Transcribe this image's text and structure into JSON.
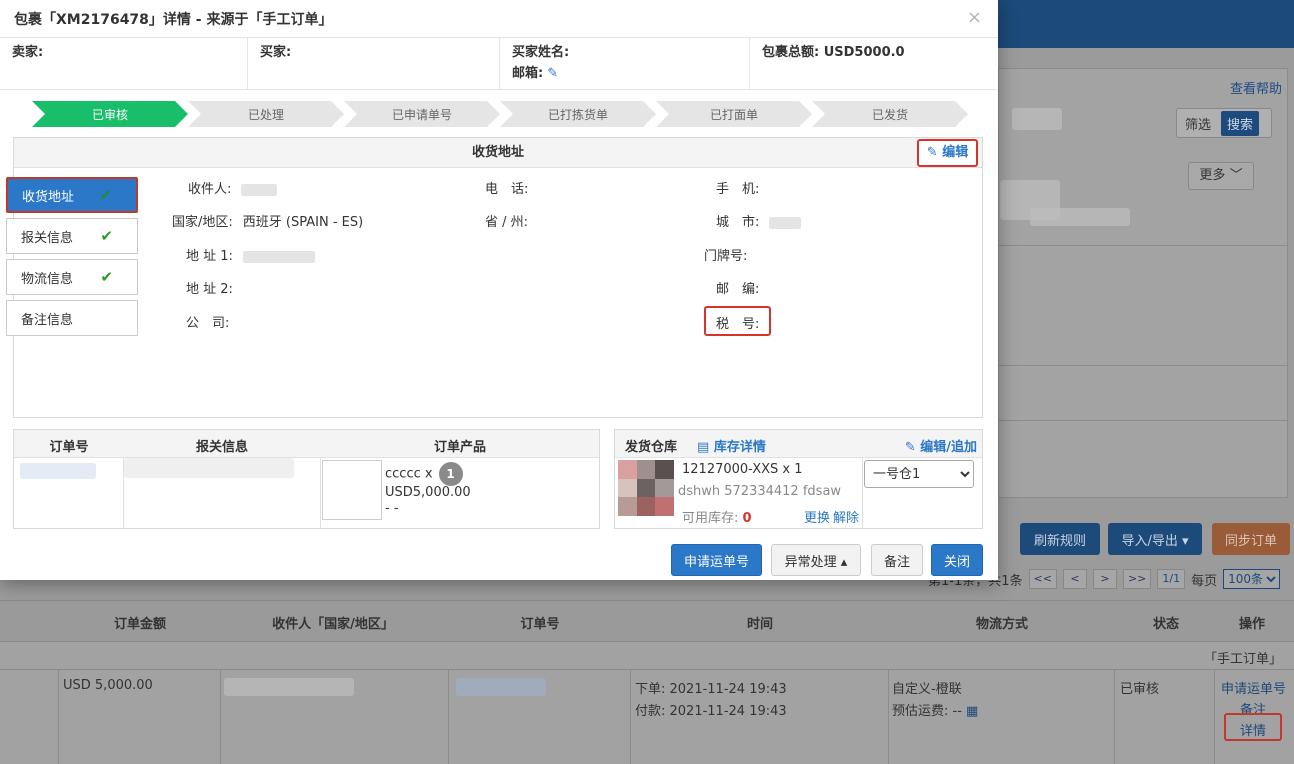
{
  "modal": {
    "title": "包裹「XM2176478」详情 - 来源于「手工订单」",
    "close_glyph": "×",
    "info": {
      "seller_label": "卖家:",
      "buyer_label": "买家:",
      "buyer_name_label": "买家姓名:",
      "email_label": "邮箱:",
      "total_label": "包裹总额: USD5000.0"
    },
    "steps": [
      "已审核",
      "已处理",
      "已申请单号",
      "已打拣货单",
      "已打面单",
      "已发货"
    ],
    "active_step": 0,
    "side_tabs": [
      {
        "label": "收货地址",
        "checked": true
      },
      {
        "label": "报关信息",
        "checked": true
      },
      {
        "label": "物流信息",
        "checked": true
      },
      {
        "label": "备注信息",
        "checked": false
      }
    ],
    "check_glyph": "✔",
    "address": {
      "title": "收货地址",
      "edit": "编辑",
      "recipient": "收件人:",
      "phone": "电　话:",
      "mobile": "手　机:",
      "country_label": "国家/地区:",
      "country_value": "西班牙 (SPAIN - ES)",
      "province": "省 / 州:",
      "city": "城　市:",
      "addr1": "地 址 1:",
      "house_no": "门牌号:",
      "addr2": "地 址 2:",
      "zip": "邮　编:",
      "company": "公　司:",
      "tax_no": "税　号:"
    },
    "order_table": {
      "headers": [
        "订单号",
        "报关信息",
        "订单产品"
      ],
      "product_sku": "ccccc x",
      "product_qty": "1",
      "product_price": "USD5,000.00",
      "product_extra": "- -"
    },
    "warehouse": {
      "label": "发货仓库",
      "stock_detail": "库存详情",
      "edit_add": "编辑/追加",
      "sku": "12127000-XXS x 1",
      "desc": "dshwh 572334412 fdsaw",
      "avail_label": "可用库存:",
      "avail_value": "0",
      "replace": "更换",
      "release": "解除",
      "select_value": "一号仓1"
    },
    "buttons": {
      "apply": "申请运单号",
      "exception": "异常处理 ▴",
      "remark": "备注",
      "close": "关闭"
    }
  },
  "background": {
    "help": "查看帮助",
    "filter": "筛选",
    "search": "搜索",
    "more": "更多",
    "refresh_rule": "刷新规则",
    "import_export": "导入/导出 ▾",
    "sync_orders": "同步订单",
    "pager_text": "第1-1条，共1条",
    "pager_first": "<<",
    "pager_prev": "<",
    "pager_next": ">",
    "pager_last": ">>",
    "pager_current": "1/1",
    "per_page_label": "每页",
    "per_page_value": "100条",
    "table_headers": [
      "订单金额",
      "收件人「国家/地区」",
      "订单号",
      "时间",
      "物流方式",
      "状态",
      "操作"
    ],
    "source_tag": "「手工订单」",
    "row": {
      "amount": "USD 5,000.00",
      "order_time": "下单: 2021-11-24 19:43",
      "pay_time": "付款: 2021-11-24 19:43",
      "shipping": "自定义-橙联",
      "est_fee": "预估运费: --",
      "status": "已审核",
      "op_apply": "申请运单号",
      "op_remark": "备注",
      "op_detail": "详情"
    }
  },
  "colors": {
    "primary": "#2a78c7",
    "step_active": "#19be6b",
    "highlight_red": "#d8342c"
  }
}
